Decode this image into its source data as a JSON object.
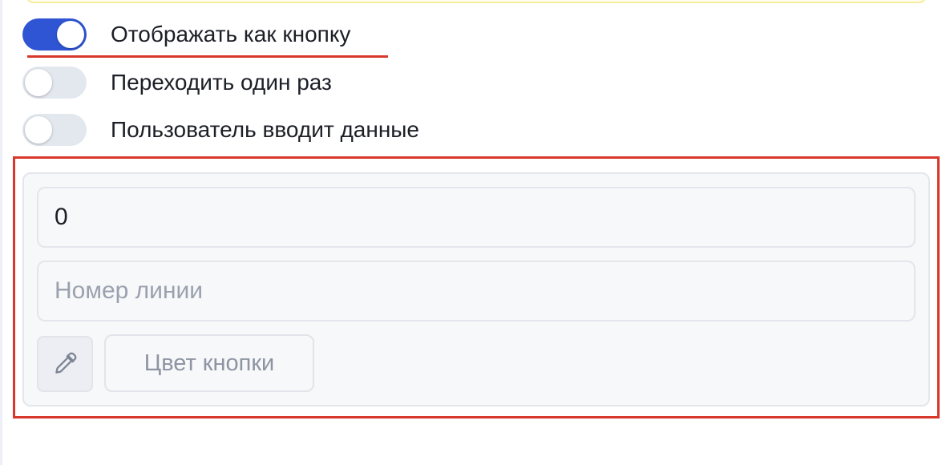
{
  "toggles": [
    {
      "label": "Отображать как кнопку",
      "on": true
    },
    {
      "label": "Переходить один раз",
      "on": false
    },
    {
      "label": "Пользователь вводит данные",
      "on": false
    }
  ],
  "panel": {
    "value_field": {
      "value": "0"
    },
    "line_field": {
      "placeholder": "Номер линии"
    },
    "picker_icon": "eyedropper-icon",
    "color_button_label": "Цвет кнопки"
  },
  "colors": {
    "accent": "#2f55d4",
    "toggle_off": "#e3e7ee",
    "highlight": "#d8382c",
    "banner_border": "#f6ed9c"
  }
}
